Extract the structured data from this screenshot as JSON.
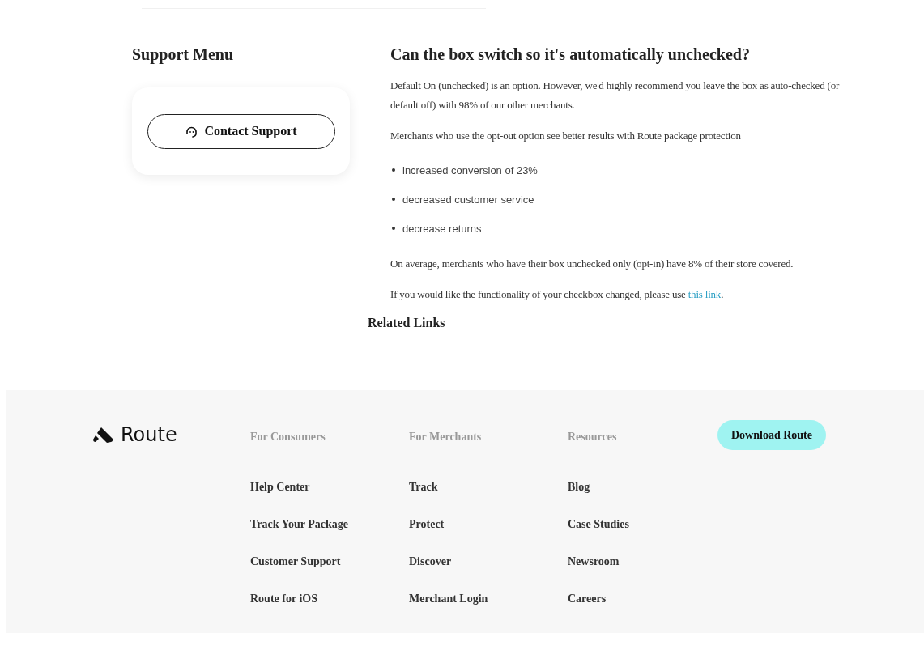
{
  "sidebar": {
    "title": "Support Menu",
    "button": "Contact Support"
  },
  "article": {
    "title": "Can the box switch so it's automatically unchecked?",
    "paragraphs": [
      "Default On (unchecked) is an option. However, we'd highly recommend you leave the box as auto-checked (or default off) with 98% of our other merchants.",
      "Merchants who use the opt-out option see better results with Route package protection"
    ],
    "bullets": [
      "increased conversion of 23%",
      "decreased customer service",
      "decrease returns"
    ],
    "closing": "On average, merchants who have their box unchecked only (opt-in) have 8% of their store covered.",
    "link_paragraph": {
      "before": "If you would like the functionality of your checkbox changed, please use ",
      "link": "this link",
      "after": "."
    }
  },
  "related_links": {
    "title": "Related Links"
  },
  "footer": {
    "logo": "Route",
    "download_button": "Download Route",
    "columns": [
      {
        "title": "For Consumers",
        "links": [
          "Help Center",
          "Track Your Package",
          "Customer Support",
          "Route for iOS"
        ]
      },
      {
        "title": "For Merchants",
        "links": [
          "Track",
          "Protect",
          "Discover",
          "Merchant Login"
        ]
      },
      {
        "title": "Resources",
        "links": [
          "Blog",
          "Case Studies",
          "Newsroom",
          "Careers"
        ]
      }
    ]
  }
}
